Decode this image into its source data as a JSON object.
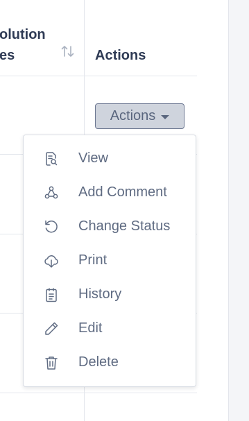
{
  "table": {
    "headers": {
      "resolution_line1": "olution",
      "resolution_line2": "es",
      "actions": "Actions"
    }
  },
  "actions_button": {
    "label": "Actions"
  },
  "menu": {
    "items": [
      {
        "label": "View",
        "icon": "document-search-icon"
      },
      {
        "label": "Add Comment",
        "icon": "share-nodes-icon"
      },
      {
        "label": "Change Status",
        "icon": "rotate-icon"
      },
      {
        "label": "Print",
        "icon": "cloud-download-icon"
      },
      {
        "label": "History",
        "icon": "clipboard-list-icon"
      },
      {
        "label": "Edit",
        "icon": "pencil-icon"
      },
      {
        "label": "Delete",
        "icon": "trash-icon"
      }
    ]
  },
  "colors": {
    "text": "#2f3b55",
    "menu_text": "#5f6b82",
    "button_bg": "#cfd4dd",
    "border": "#e3e6ec"
  }
}
